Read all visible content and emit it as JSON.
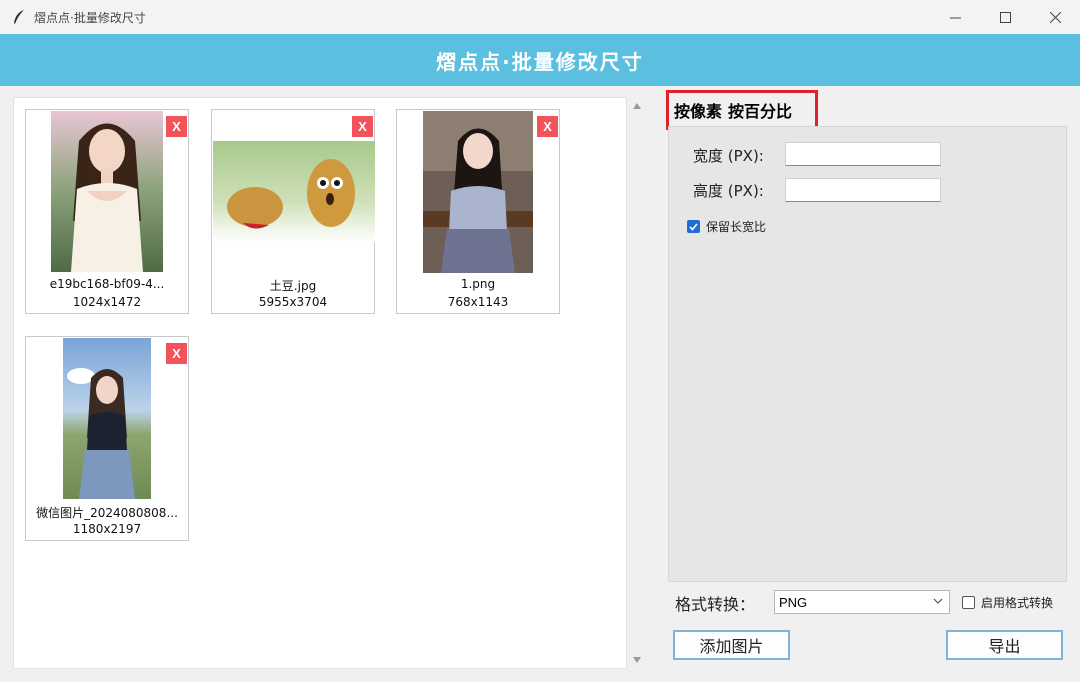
{
  "window": {
    "title": "熠点点·批量修改尺寸"
  },
  "banner": {
    "title": "熠点点·批量修改尺寸"
  },
  "images": [
    {
      "name": "e19bc168-bf09-4...",
      "dims": "1024x1472",
      "close": "X"
    },
    {
      "name": "土豆.jpg",
      "dims": "5955x3704",
      "close": "X"
    },
    {
      "name": "1.png",
      "dims": "768x1143",
      "close": "X"
    },
    {
      "name": "微信图片_2024080808...",
      "dims": "1180x2197",
      "close": "X"
    }
  ],
  "tabs": [
    {
      "label": "按像素"
    },
    {
      "label": "按百分比"
    }
  ],
  "settings": {
    "width_label": "宽度 (PX):",
    "width_value": "",
    "height_label": "高度 (PX):",
    "height_value": "",
    "keep_ratio_label": "保留长宽比",
    "keep_ratio_checked": true
  },
  "format": {
    "label": "格式转换：",
    "selected": "PNG",
    "enable_label": "启用格式转换",
    "enable_checked": false
  },
  "buttons": {
    "add": "添加图片",
    "export": "导出"
  },
  "colors": {
    "banner": "#5bbfe0",
    "close": "#f2525a",
    "tab_highlight": "#e0202b",
    "checkbox": "#1e6fd1"
  }
}
